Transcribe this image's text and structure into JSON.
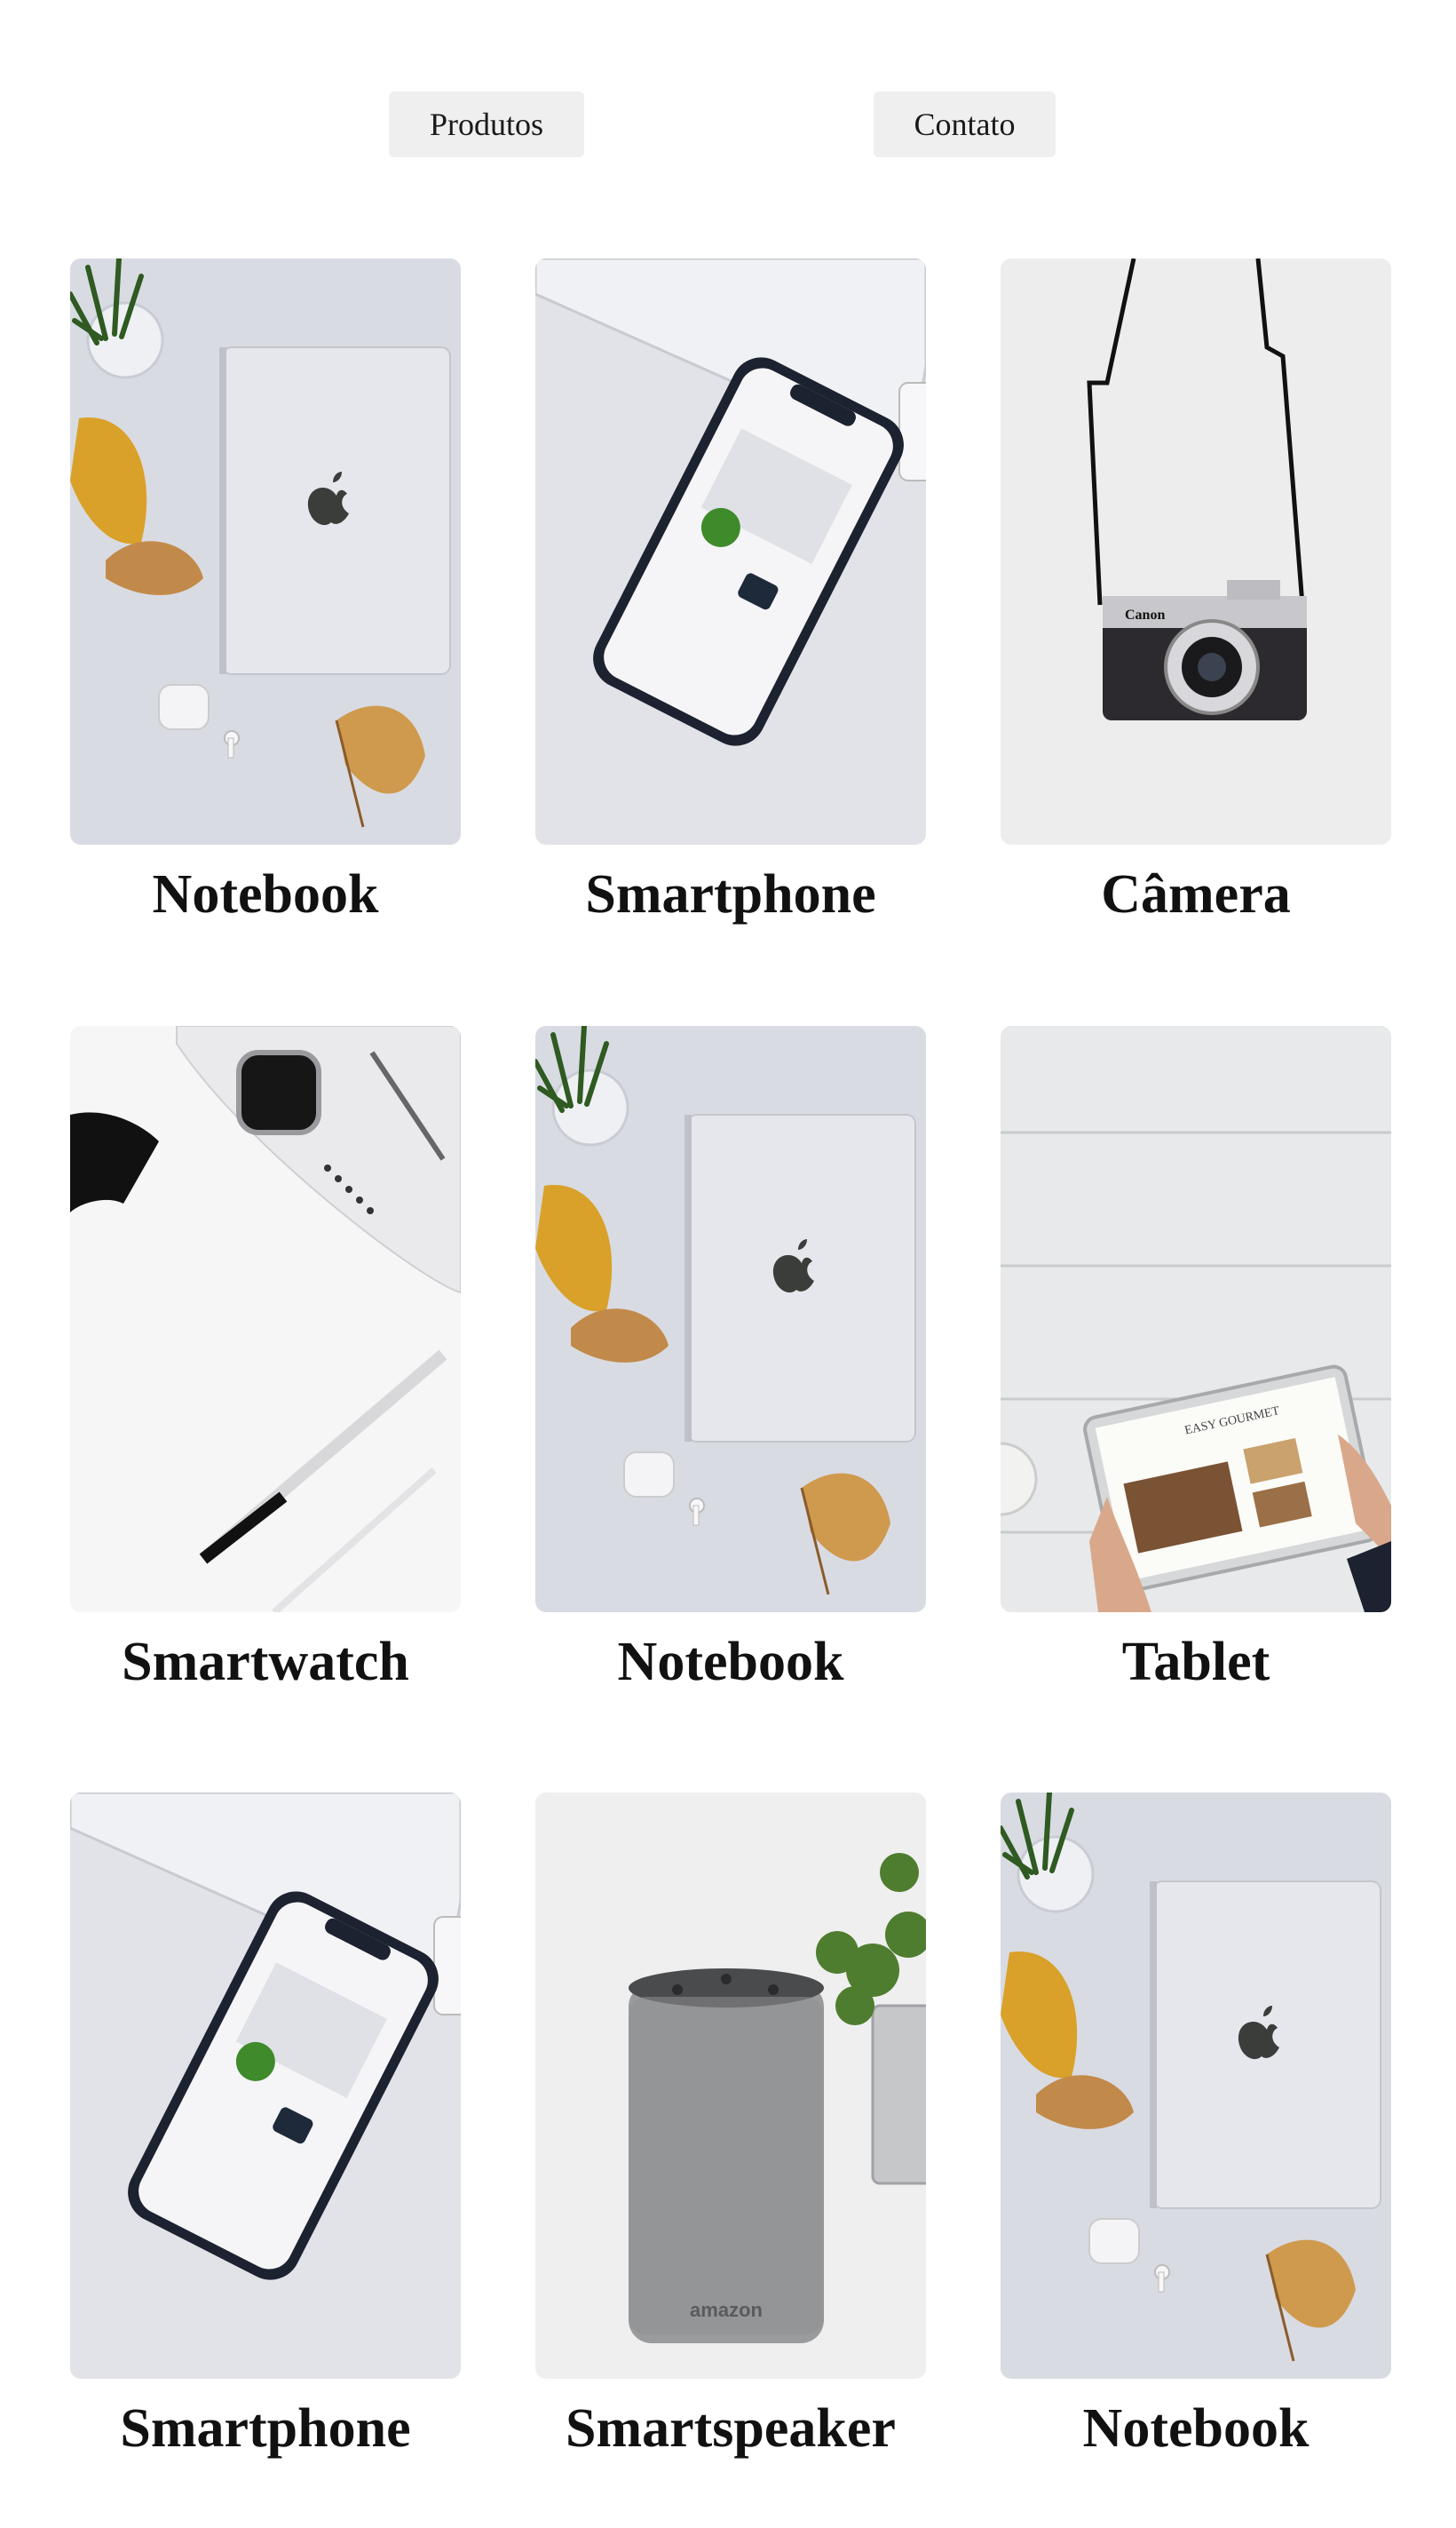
{
  "nav": {
    "produtos_label": "Produtos",
    "contato_label": "Contato"
  },
  "products": [
    {
      "name": "Notebook",
      "image": "notebook-photo"
    },
    {
      "name": "Smartphone",
      "image": "smartphone-photo"
    },
    {
      "name": "Câmera",
      "image": "camera-photo"
    },
    {
      "name": "Smartwatch",
      "image": "smartwatch-photo"
    },
    {
      "name": "Notebook",
      "image": "notebook-photo"
    },
    {
      "name": "Tablet",
      "image": "tablet-photo"
    },
    {
      "name": "Smartphone",
      "image": "smartphone-photo"
    },
    {
      "name": "Smartspeaker",
      "image": "smartspeaker-photo"
    },
    {
      "name": "Notebook",
      "image": "notebook-photo"
    }
  ],
  "speaker_brand": "amazon",
  "camera_brand": "Canon",
  "tablet_screen_title": "EASY GOURMET",
  "colors": {
    "nav_button_bg": "#efefef",
    "page_bg": "#ffffff",
    "label_text": "#111111"
  }
}
